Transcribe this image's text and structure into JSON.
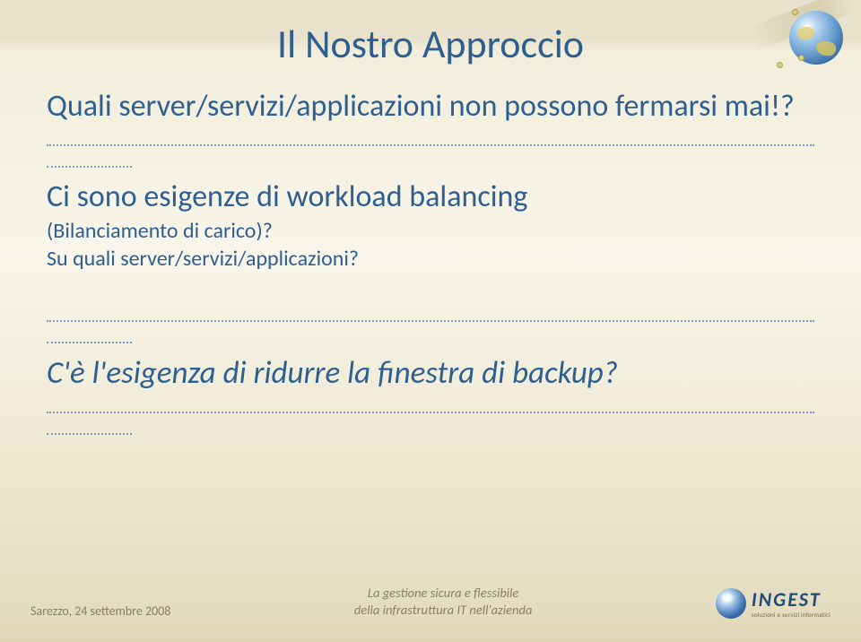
{
  "title": "Il Nostro Approccio",
  "q1": "Quali server/servizi/applicazioni non possono fermarsi mai!?",
  "dots_short_suffix": "..",
  "q2": "Ci sono esigenze di workload balancing",
  "q2_sub1": "(Bilanciamento di carico)?",
  "q2_sub2": "Su quali server/servizi/applicazioni?",
  "q3": "C'è l'esigenza di ridurre la finestra di backup?",
  "footer": {
    "date": "Sarezzo, 24 settembre 2008",
    "mid_line1": "La gestione sicura e flessibile",
    "mid_line2": "della infrastruttura IT nell'azienda",
    "logo_name": "INGEST",
    "logo_tagline": "soluzioni e servizi informatici"
  }
}
